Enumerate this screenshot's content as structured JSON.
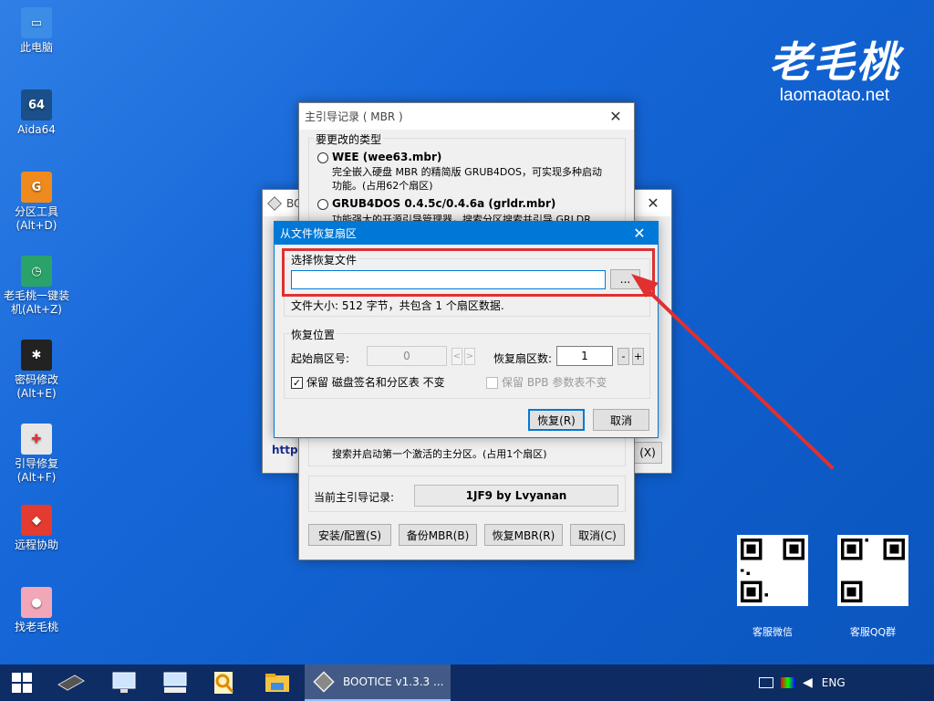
{
  "desktop": {
    "icons": [
      {
        "label": "此电脑",
        "icon": "computer-icon",
        "color": "#3c8de6"
      },
      {
        "label": "Aida64",
        "icon": "aida64-icon",
        "color": "#1a4f8a"
      },
      {
        "label": "分区工具\n(Alt+D)",
        "icon": "partition-tool-icon",
        "color": "#f08a1c"
      },
      {
        "label": "老毛桃一键装\n机(Alt+Z)",
        "icon": "one-key-install-icon",
        "color": "#2aa36a"
      },
      {
        "label": "密码修改\n(Alt+E)",
        "icon": "password-tool-icon",
        "color": "#222222"
      },
      {
        "label": "引导修复\n(Alt+F)",
        "icon": "boot-repair-icon",
        "color": "#e6e6e6"
      },
      {
        "label": "远程协助",
        "icon": "remote-assist-icon",
        "color": "#e33b2f"
      },
      {
        "label": "找老毛桃",
        "icon": "laomaotao-peach-icon",
        "color": "#f2a7b8"
      }
    ],
    "brand_cn": "老毛桃",
    "brand_en": "laomaotao.net",
    "qr_labels": [
      "客服微信",
      "客服QQ群"
    ]
  },
  "mbr_window": {
    "title": "主引导记录 ( MBR )",
    "group_title": "要更改的类型",
    "options": [
      {
        "label": "WEE (wee63.mbr)",
        "desc": "完全嵌入硬盘 MBR 的精简版 GRUB4DOS，可实现多种启动\n功能。(占用62个扇区)"
      },
      {
        "label": "GRUB4DOS 0.4.5c/0.4.6a (grldr.mbr)",
        "desc": "功能强大的开源引导管理器，搜索分区搜索并引导 GRLDR"
      }
    ],
    "partial_desc": "搜索并启动第一个激活的主分区。(占用1个扇区)",
    "current_label": "当前主引导记录:",
    "current_value": "1JF9 by Lvyanan",
    "buttons": [
      "安装/配置(S)",
      "备份MBR(B)",
      "恢复MBR(R)",
      "取消(C)"
    ]
  },
  "bootice_window": {
    "title": "BOO",
    "link_text": "http:",
    "btn_fragment": "(X)"
  },
  "restore_dialog": {
    "title": "从文件恢复扇区",
    "select_group": "选择恢复文件",
    "file_path": "",
    "browse_label": "...",
    "file_info": "文件大小: 512 字节，共包含 1 个扇区数据.",
    "position_group": "恢复位置",
    "start_sector_label": "起始扇区号:",
    "start_sector_value": "0",
    "sector_count_label": "恢复扇区数:",
    "sector_count_value": "1",
    "keep_sig_label": "保留 磁盘签名和分区表 不变",
    "keep_bpb_label": "保留 BPB 参数表不变",
    "restore_button": "恢复(R)",
    "cancel_button": "取消",
    "colors": {
      "title_bg": "#0078d7",
      "highlight": "#e03030"
    }
  },
  "taskbar": {
    "active_app": "BOOTICE v1.3.3 ...",
    "language": "ENG",
    "icons": [
      "start-icon",
      "memory-chip-icon",
      "control-panel-icon",
      "keyboard-icon",
      "search-magnifier-icon",
      "file-explorer-icon",
      "bootice-icon"
    ]
  }
}
